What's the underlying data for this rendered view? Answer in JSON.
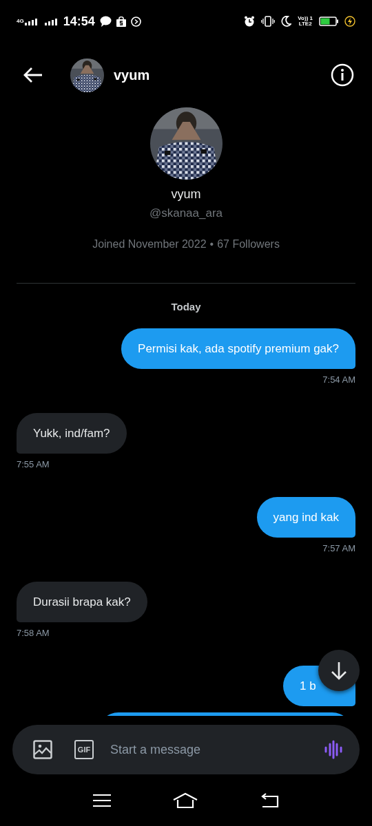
{
  "status_bar": {
    "network": "4G",
    "time": "14:54",
    "volte_top": "Vo)) 1",
    "volte_bottom": "LTE2",
    "charging": true
  },
  "header": {
    "name": "vyum"
  },
  "profile": {
    "name": "vyum",
    "handle": "@skanaa_ara",
    "joined": "Joined November 2022",
    "separator": "•",
    "followers": "67 Followers"
  },
  "date_divider": "Today",
  "messages": [
    {
      "sent": true,
      "text": "Permisi kak, ada spotify premium gak?",
      "time": "7:54 AM"
    },
    {
      "sent": false,
      "text": "Yukk, ind/fam?",
      "time": "7:55 AM"
    },
    {
      "sent": true,
      "text": "yang ind kak",
      "time": "7:57 AM"
    },
    {
      "sent": false,
      "text": "Durasii brapa kak?",
      "time": "7:58 AM"
    },
    {
      "sent": true,
      "text": "1 b"
    },
    {
      "sent": true,
      "cut": true
    }
  ],
  "composer": {
    "placeholder": "Start a message",
    "gif_label": "GIF"
  }
}
